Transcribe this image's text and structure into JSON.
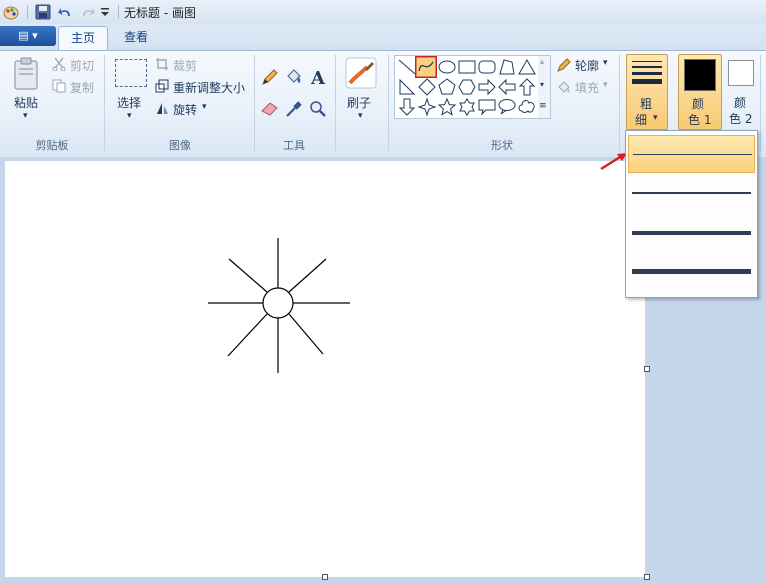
{
  "window": {
    "title": "无标题 - 画图"
  },
  "tabs": [
    {
      "label": "主页"
    },
    {
      "label": "查看"
    }
  ],
  "app_menu": {
    "label": "▤ ▾"
  },
  "ribbon": {
    "clipboard": {
      "paste": "粘贴",
      "cut": "剪切",
      "copy": "复制",
      "group": "剪贴板"
    },
    "image": {
      "select": "选择",
      "crop": "裁剪",
      "resize": "重新调整大小",
      "rotate": "旋转",
      "group": "图像"
    },
    "tools": {
      "group": "工具"
    },
    "brushes": {
      "label": "刷子"
    },
    "shapes": {
      "outline": "轮廓",
      "fill": "填充",
      "group": "形状"
    },
    "size": {
      "label_line1": "粗",
      "label_line2": "细"
    },
    "color1": {
      "label_line1": "颜",
      "label_line2": "色 1",
      "value": "#000000"
    },
    "color2": {
      "label_line1": "颜",
      "label_line2": "色 2",
      "value": "#ffffff"
    }
  },
  "size_dropdown": {
    "options": [
      {
        "width": 1
      },
      {
        "width": 3
      },
      {
        "width": 5
      },
      {
        "width": 8
      }
    ],
    "selected_index": 0
  }
}
